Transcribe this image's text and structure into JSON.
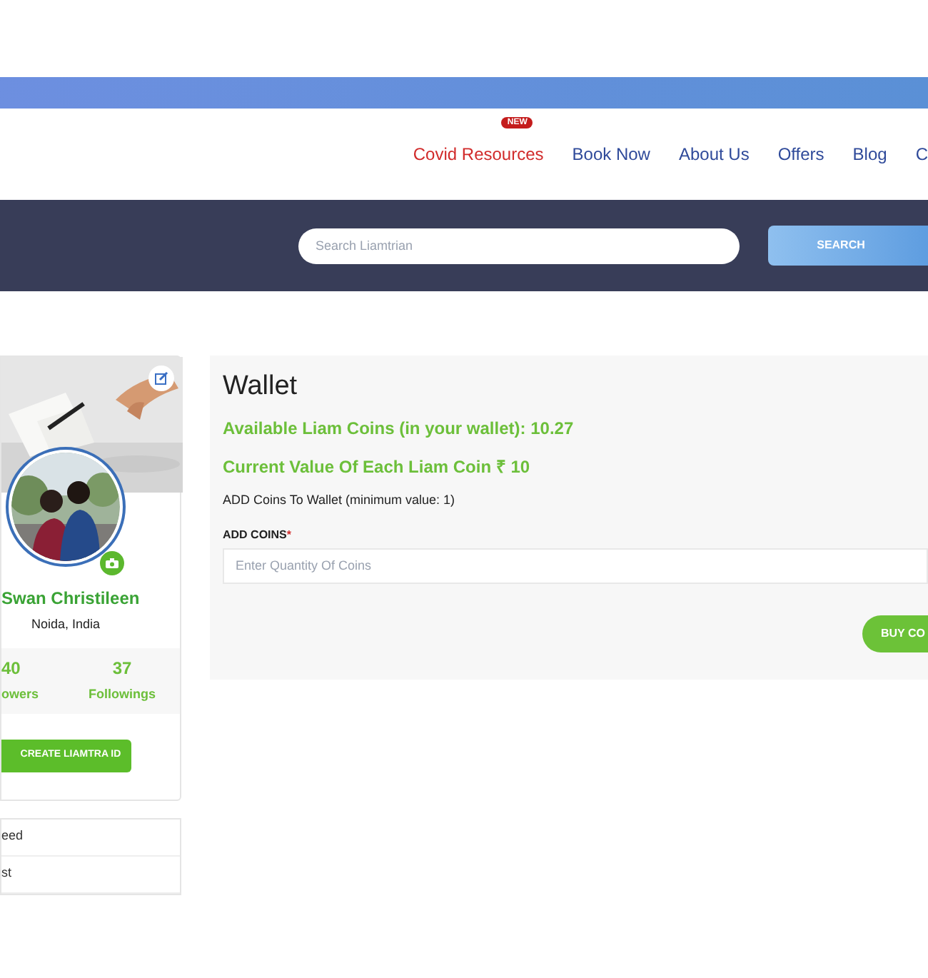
{
  "nav": {
    "items": [
      {
        "label": "Covid Resources",
        "kind": "highlight",
        "badge": "NEW"
      },
      {
        "label": "Book Now",
        "kind": "link"
      },
      {
        "label": "About Us",
        "kind": "link"
      },
      {
        "label": "Offers",
        "kind": "link"
      },
      {
        "label": "Blog",
        "kind": "link"
      },
      {
        "label": "C",
        "kind": "link"
      }
    ]
  },
  "search": {
    "placeholder": "Search Liamtrian",
    "button": "SEARCH"
  },
  "profile": {
    "name": "Swan Christileen",
    "location": "Noida, India",
    "stats": [
      {
        "value": "40",
        "label": "owers"
      },
      {
        "value": "37",
        "label": "Followings"
      }
    ],
    "button": "CREATE LIAMTRA ID",
    "menu": [
      "eed",
      "st"
    ]
  },
  "wallet": {
    "title": "Wallet",
    "available": "Available Liam Coins (in your wallet): 10.27",
    "value": "Current Value Of Each Liam Coin ₹ 10",
    "hint": "ADD Coins To Wallet (minimum value: 1)",
    "field_label": "ADD COINS",
    "required_mark": "*",
    "placeholder": "Enter Quantity Of Coins",
    "button": "BUY CO"
  }
}
